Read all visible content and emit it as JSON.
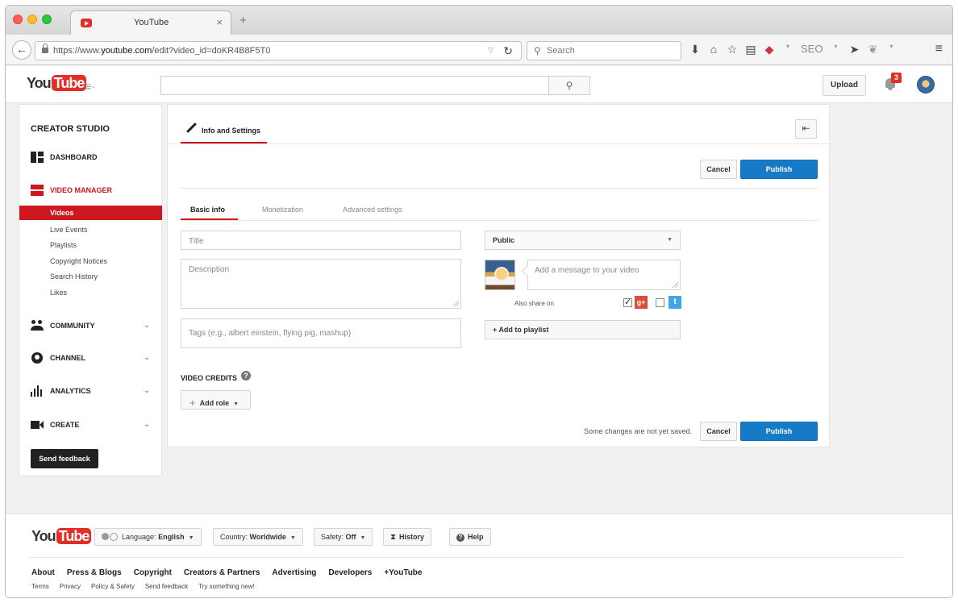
{
  "browser": {
    "tab_title": "YouTube",
    "url_prefix": "https://www.",
    "url_domain": "youtube.com",
    "url_path": "/edit?video_id=doKR4B8F5T0",
    "search_placeholder": "Search",
    "seo_label": "SEO"
  },
  "masthead": {
    "logo_you": "You",
    "logo_tube": "Tube",
    "search_value": "",
    "upload_label": "Upload",
    "notification_count": "3"
  },
  "sidebar": {
    "title": "CREATOR STUDIO",
    "dashboard": "DASHBOARD",
    "video_manager": "VIDEO MANAGER",
    "video_manager_items": [
      "Videos",
      "Live Events",
      "Playlists",
      "Copyright Notices",
      "Search History",
      "Likes"
    ],
    "community": "COMMUNITY",
    "channel": "CHANNEL",
    "analytics": "ANALYTICS",
    "create": "CREATE",
    "feedback": "Send feedback"
  },
  "main": {
    "tab_label": "Info and Settings",
    "cancel": "Cancel",
    "publish": "Publish",
    "subtabs": [
      "Basic info",
      "Monetization",
      "Advanced settings"
    ],
    "title_placeholder": "Title",
    "description_placeholder": "Description",
    "tags_placeholder": "Tags (e.g., albert einstein, flying pig, mashup)",
    "privacy": "Public",
    "message_placeholder": "Add a message to your video",
    "also_share": "Also share on",
    "add_playlist": "+ Add to playlist",
    "credits_title": "VIDEO CREDITS",
    "add_role": "Add role",
    "unsaved": "Some changes are not yet saved."
  },
  "footer": {
    "language_label": "Language:",
    "language_value": "English",
    "country_label": "Country:",
    "country_value": "Worldwide",
    "safety_label": "Safety:",
    "safety_value": "Off",
    "history": "History",
    "help": "Help",
    "links": [
      "About",
      "Press & Blogs",
      "Copyright",
      "Creators & Partners",
      "Advertising",
      "Developers",
      "+YouTube"
    ],
    "sublinks": [
      "Terms",
      "Privacy",
      "Policy & Safety",
      "Send feedback",
      "Try something new!"
    ]
  },
  "colors": {
    "youtube_red": "#cc181e",
    "publish_blue": "#167ac6",
    "gplus_red": "#dd4b39",
    "twitter_blue": "#3fa6e6"
  }
}
